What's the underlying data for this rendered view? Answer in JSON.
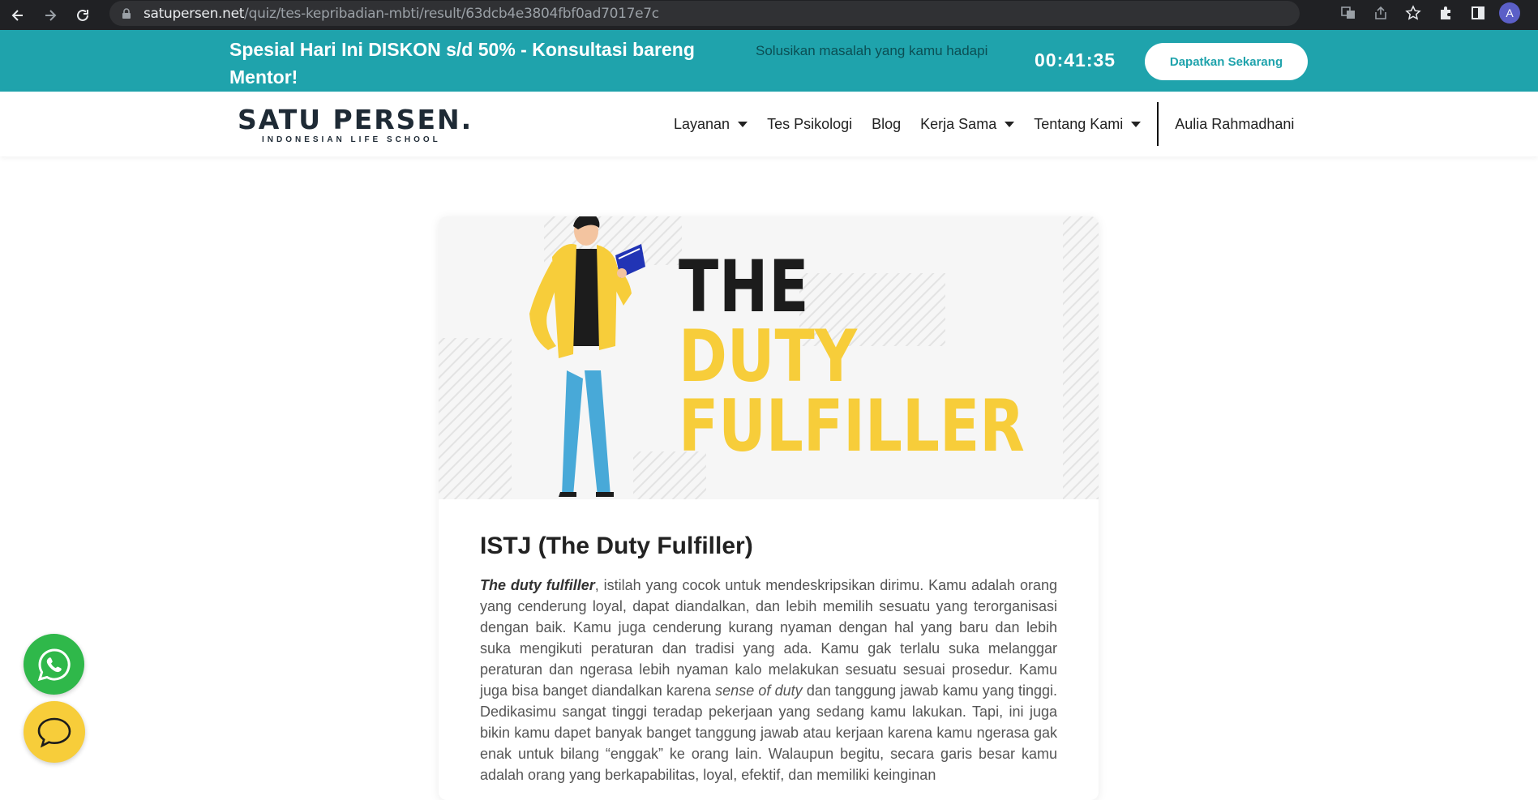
{
  "browser": {
    "url_host": "satupersen.net",
    "url_path": "/quiz/tes-kepribadian-mbti/result/63dcb4e3804fbf0ad7017e7c",
    "profile_initial": "A"
  },
  "promo": {
    "title": "Spesial Hari Ini DISKON s/d 50% - Konsultasi bareng Mentor!",
    "subtitle": "Solusikan masalah yang kamu hadapi",
    "timer": "00:41:35",
    "cta_label": "Dapatkan Sekarang"
  },
  "header": {
    "logo_main": "SATU PERSEN.",
    "logo_sub": "INDONESIAN LIFE SCHOOL",
    "menu": [
      {
        "label": "Layanan",
        "dropdown": true
      },
      {
        "label": "Tes Psikologi",
        "dropdown": false
      },
      {
        "label": "Blog",
        "dropdown": false
      },
      {
        "label": "Kerja Sama",
        "dropdown": true
      },
      {
        "label": "Tentang Kami",
        "dropdown": true
      }
    ],
    "user_name": "Aulia Rahmadhani"
  },
  "hero": {
    "line1": "THE",
    "line2": "DUTY",
    "line3": "FULFILLER"
  },
  "result": {
    "title": "ISTJ (The Duty Fulfiller)",
    "lead": "The duty fulfiller",
    "body_part1": ", istilah yang cocok untuk mendeskripsikan dirimu. Kamu adalah orang yang cenderung loyal, dapat diandalkan, dan lebih memilih sesuatu yang terorganisasi dengan baik. Kamu juga cenderung kurang nyaman dengan hal yang baru dan lebih suka mengikuti peraturan dan tradisi yang ada. Kamu gak terlalu suka melanggar peraturan dan ngerasa lebih nyaman kalo melakukan sesuatu sesuai prosedur. Kamu juga bisa banget diandalkan karena ",
    "emphasis": "sense of duty",
    "body_part2": " dan tanggung jawab kamu yang tinggi. Dedikasimu sangat tinggi teradap pekerjaan yang sedang kamu lakukan. Tapi, ini juga bikin kamu dapet banyak banget tanggung jawab atau kerjaan karena kamu ngerasa gak enak untuk bilang “enggak” ke orang lain. Walaupun begitu, secara garis besar kamu adalah orang yang berkapabilitas, loyal, efektif, dan memiliki keinginan"
  },
  "colors": {
    "brand_teal": "#1fa3ac",
    "accent_yellow": "#f7cd3a",
    "whatsapp_green": "#2fb84a"
  },
  "icons": [
    "back-icon",
    "forward-icon",
    "reload-icon",
    "lock-icon",
    "translate-icon",
    "share-icon",
    "star-icon",
    "extensions-icon",
    "sidepanel-icon",
    "whatsapp-icon",
    "chat-icon"
  ]
}
